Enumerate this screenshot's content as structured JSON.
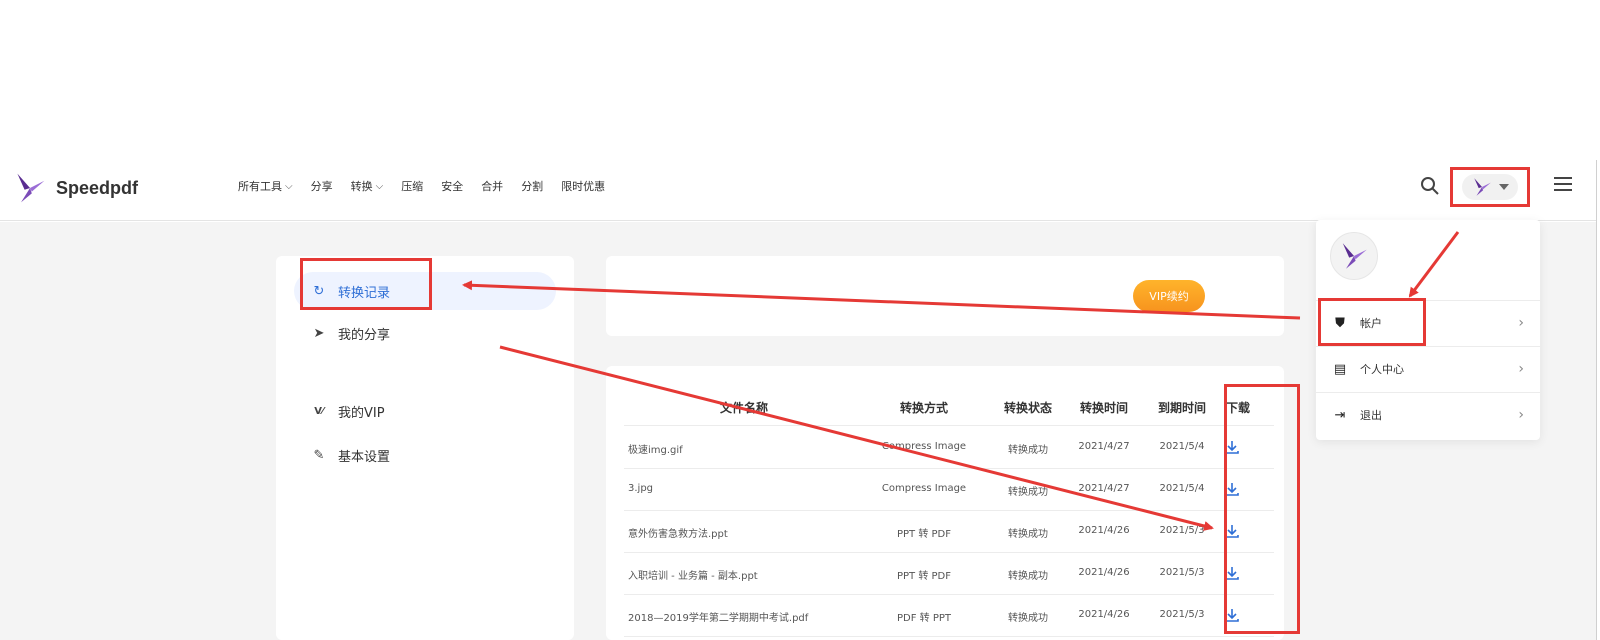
{
  "brand": {
    "name": "Speedpdf",
    "logo_icon": "butterfly-logo-icon",
    "color": "#7b4bb8"
  },
  "nav": [
    {
      "label": "所有工具",
      "dropdown": true
    },
    {
      "label": "分享",
      "dropdown": false
    },
    {
      "label": "转换",
      "dropdown": true
    },
    {
      "label": "压缩",
      "dropdown": false
    },
    {
      "label": "安全",
      "dropdown": false
    },
    {
      "label": "合并",
      "dropdown": false
    },
    {
      "label": "分割",
      "dropdown": false
    },
    {
      "label": "限时优惠",
      "dropdown": false
    }
  ],
  "header_icons": {
    "search": "search-icon",
    "menu": "hamburger-menu-icon"
  },
  "sidebar": {
    "items": [
      {
        "label": "转换记录",
        "icon": "refresh-icon",
        "active": true
      },
      {
        "label": "我的分享",
        "icon": "paper-plane-icon",
        "active": false
      },
      {
        "label": "我的VIP",
        "icon": "vip-icon",
        "active": false
      },
      {
        "label": "基本设置",
        "icon": "pencil-icon",
        "active": false
      }
    ]
  },
  "vip_card": {
    "button_label": "VIP续约"
  },
  "table": {
    "headers": [
      "文件名称",
      "转换方式",
      "转换状态",
      "转换时间",
      "到期时间",
      "下载"
    ],
    "rows": [
      {
        "name": "极速img.gif",
        "method": "Compress Image",
        "status": "转换成功",
        "time": "2021/4/27",
        "expire": "2021/5/4"
      },
      {
        "name": "3.jpg",
        "method": "Compress Image",
        "status": "转换成功",
        "time": "2021/4/27",
        "expire": "2021/5/4"
      },
      {
        "name": "意外伤害急救方法.ppt",
        "method": "PPT 转 PDF",
        "status": "转换成功",
        "time": "2021/4/26",
        "expire": "2021/5/3"
      },
      {
        "name": "入职培训 - 业务篇 - 副本.ppt",
        "method": "PPT 转 PDF",
        "status": "转换成功",
        "time": "2021/4/26",
        "expire": "2021/5/3"
      },
      {
        "name": "2018—2019学年第二学期期中考试.pdf",
        "method": "PDF 转 PPT",
        "status": "转换成功",
        "time": "2021/4/26",
        "expire": "2021/5/3"
      }
    ]
  },
  "user_menu": {
    "items": [
      {
        "label": "帐户",
        "icon": "shield-icon"
      },
      {
        "label": "个人中心",
        "icon": "id-card-icon"
      },
      {
        "label": "退出",
        "icon": "sign-out-icon"
      }
    ]
  },
  "colors": {
    "annotation_red": "#e53935",
    "accent_blue": "#2f6fd6",
    "vip_orange": "#f7931e"
  }
}
